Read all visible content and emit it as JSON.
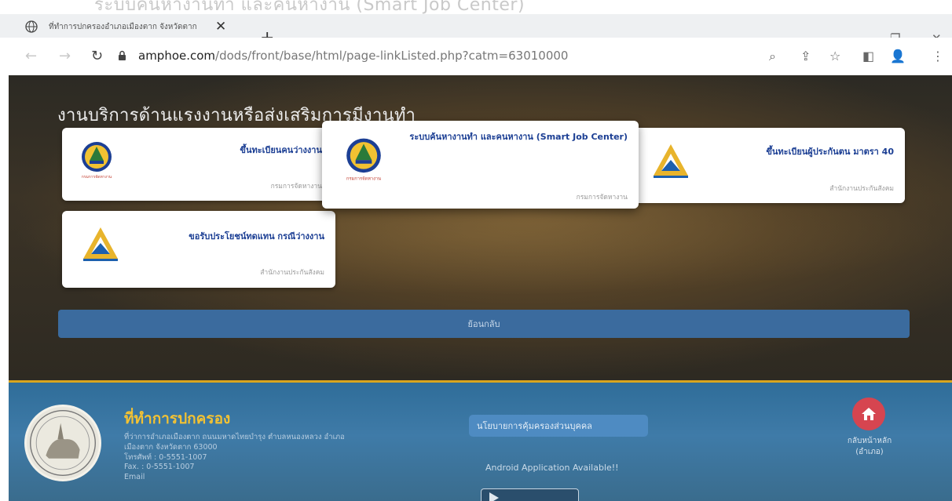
{
  "doc_title": "ระบบค้นหางานทำ และคนหางาน (Smart Job Center)",
  "tab": {
    "title": "ที่ทำการปกครองอำเภอเมืองตาก จังหวัดตาก",
    "close": "✕"
  },
  "new_tab": "+",
  "window_controls": {
    "collapse": "⌵",
    "minimize": "—",
    "restore": "❐",
    "close": "✕"
  },
  "address": {
    "host": "amphoe.com",
    "path": "/dods/front/base/html/page-linkListed.php?catm=63010000"
  },
  "section": {
    "heading": "งานบริการด้านแรงงานหรือส่งเสริมการมีงานทำ"
  },
  "cards": [
    {
      "title": "ขึ้นทะเบียนคนว่างงาน",
      "agency": "กรมการจัดหางาน",
      "logo": "doe-logo"
    },
    {
      "title": "ระบบค้นหางานทำ และคนหางาน (Smart Job Center)",
      "agency": "กรมการจัดหางาน",
      "logo": "doe-logo"
    },
    {
      "title": "ขึ้นทะเบียนผู้ประกันตน มาตรา 40",
      "agency": "สำนักงานประกันสังคม",
      "logo": "sso-logo"
    },
    {
      "title": "ขอรับประโยชน์ทดแทน กรณีว่างงาน",
      "agency": "สำนักงานประกันสังคม",
      "logo": "sso-logo"
    }
  ],
  "back_button": "ย้อนกลับ",
  "footer": {
    "title": "ที่ทำการปกครอง",
    "address_lines": [
      "ที่ว่าการอำเภอเมืองตาก ถนนมหาดไทยบำรุง ตำบลหนองหลวง อำเภอ",
      "เมืองตาก จังหวัดตาก 63000",
      "โทรศัพท์ : 0-5551-1007",
      "Fax. : 0-5551-1007",
      "Email"
    ],
    "privacy_button": "นโยบายการคุ้มครองส่วนบุคคล",
    "android_text": "Android Application Available!!",
    "home_label_line1": "กลับหน้าหลัก",
    "home_label_line2": "(อำเภอ)"
  },
  "colors": {
    "card_title": "#1c3f94",
    "back_bar": "#3b6b9e",
    "footer_bg": "#3f7ba8",
    "footer_title": "#f3c233",
    "home_button": "#d64550"
  }
}
